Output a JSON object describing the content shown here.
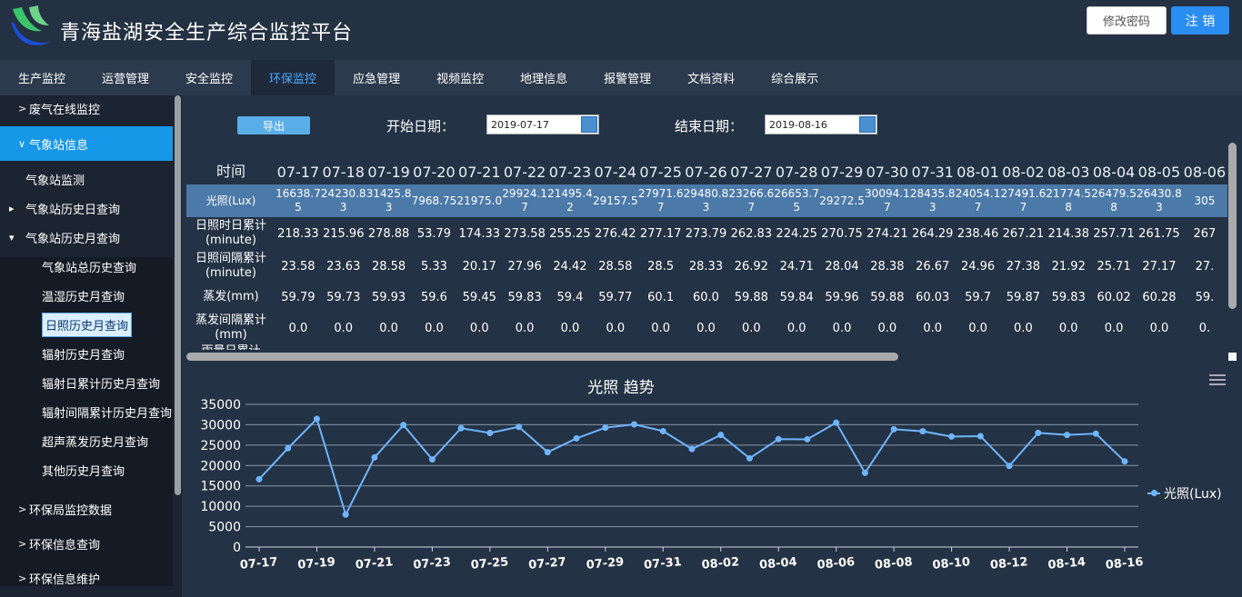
{
  "app": {
    "title": "青海盐湖安全生产综合监控平台",
    "btn_password": "修改密码",
    "btn_logout": "注 销"
  },
  "nav": [
    "生产监控",
    "运营管理",
    "安全监控",
    "环保监控",
    "应急管理",
    "视频监控",
    "地理信息",
    "报警管理",
    "文档资料",
    "综合展示"
  ],
  "nav_active": 3,
  "sidebar": {
    "top": "废气在线监控",
    "active": "气象站信息",
    "sub": [
      "气象站监测",
      "气象站历史日查询",
      "气象站历史月查询"
    ],
    "subsub": [
      "气象站总历史查询",
      "温湿历史月查询",
      "日照历史月查询",
      "辐射历史月查询",
      "辐射日累计历史月查询",
      "辐射间隔累计历史月查询",
      "超声蒸发历史月查询",
      "其他历史月查询"
    ],
    "bottom": [
      "环保局监控数据",
      "环保信息查询",
      "环保信息维护"
    ]
  },
  "filters": {
    "export": "导出",
    "start_label": "开始日期：",
    "start": "2019-07-17",
    "end_label": "结束日期：",
    "end": "2019-08-16"
  },
  "table": {
    "time_label": "时间",
    "dates": [
      "07-17",
      "07-18",
      "07-19",
      "07-20",
      "07-21",
      "07-22",
      "07-23",
      "07-24",
      "07-25",
      "07-26",
      "07-27",
      "07-28",
      "07-29",
      "07-30",
      "07-31",
      "08-01",
      "08-02",
      "08-03",
      "08-04",
      "08-05",
      "08-06"
    ],
    "rows": [
      {
        "label": "光照(Lux)",
        "values": [
          "16638.75",
          "24230.83",
          "31425.83",
          "7968.75",
          "21975.0",
          "29924.17",
          "21495.42",
          "29157.5",
          "27971.67",
          "29480.83",
          "23266.67",
          "26653.75",
          "29272.5",
          "30094.17",
          "28435.83",
          "24054.17",
          "27491.67",
          "21774.58",
          "26479.58",
          "26430.83",
          "305"
        ]
      },
      {
        "label": "日照时日累计(minute)",
        "values": [
          "218.33",
          "215.96",
          "278.88",
          "53.79",
          "174.33",
          "273.58",
          "255.25",
          "276.42",
          "277.17",
          "273.79",
          "262.83",
          "224.25",
          "270.75",
          "274.21",
          "264.29",
          "238.46",
          "267.21",
          "214.38",
          "257.71",
          "261.75",
          "267"
        ]
      },
      {
        "label": "日照间隔累计(minute)",
        "values": [
          "23.58",
          "23.63",
          "28.58",
          "5.33",
          "20.17",
          "27.96",
          "24.42",
          "28.58",
          "28.5",
          "28.33",
          "26.92",
          "24.71",
          "28.04",
          "28.38",
          "26.67",
          "24.96",
          "27.38",
          "21.92",
          "25.71",
          "27.17",
          "27."
        ]
      },
      {
        "label": "蒸发(mm)",
        "values": [
          "59.79",
          "59.73",
          "59.93",
          "59.6",
          "59.45",
          "59.83",
          "59.4",
          "59.77",
          "60.1",
          "60.0",
          "59.88",
          "59.84",
          "59.96",
          "59.88",
          "60.03",
          "59.7",
          "59.87",
          "59.83",
          "60.02",
          "60.28",
          "59."
        ]
      },
      {
        "label": "蒸发间隔累计(mm)",
        "values": [
          "0.0",
          "0.0",
          "0.0",
          "0.0",
          "0.0",
          "0.0",
          "0.0",
          "0.0",
          "0.0",
          "0.0",
          "0.0",
          "0.0",
          "0.0",
          "0.0",
          "0.0",
          "0.0",
          "0.0",
          "0.0",
          "0.0",
          "0.0",
          "0."
        ]
      },
      {
        "label": "雨量日累计",
        "values": []
      }
    ]
  },
  "chart_data": {
    "type": "line",
    "title": "光照 趋势",
    "legend": "光照(Lux)",
    "legend_position": "right",
    "ylim": [
      0,
      35000
    ],
    "yticks": [
      "35000",
      "30000",
      "25000",
      "20000",
      "15000",
      "10000",
      "5000",
      "0"
    ],
    "x": [
      "07-17",
      "07-18",
      "07-19",
      "07-20",
      "07-21",
      "07-22",
      "07-23",
      "07-24",
      "07-25",
      "07-26",
      "07-27",
      "07-28",
      "07-29",
      "07-30",
      "07-31",
      "08-01",
      "08-02",
      "08-03",
      "08-04",
      "08-05",
      "08-06",
      "08-07",
      "08-08",
      "08-09",
      "08-10",
      "08-11",
      "08-12",
      "08-13",
      "08-14",
      "08-15",
      "08-16"
    ],
    "xtick_labels": [
      "07-17",
      "07-19",
      "07-21",
      "07-23",
      "07-25",
      "07-27",
      "07-29",
      "07-31",
      "08-02",
      "08-04",
      "08-06",
      "08-08",
      "08-10",
      "08-12",
      "08-14",
      "08-16"
    ],
    "values": [
      16639,
      24231,
      31426,
      7969,
      21975,
      29924,
      21495,
      29158,
      27972,
      29481,
      23267,
      26654,
      29273,
      30094,
      28436,
      24054,
      27492,
      21775,
      26480,
      26431,
      30500,
      18200,
      28900,
      28400,
      27100,
      27200,
      19900,
      28000,
      27500,
      27800,
      21000
    ],
    "color": "#6fb5ff"
  }
}
